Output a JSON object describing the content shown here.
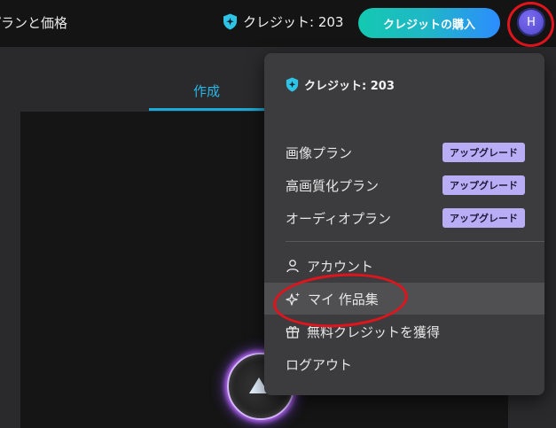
{
  "header": {
    "nav_link": "プランと価格",
    "credits_label": "クレジット: 203",
    "buy_button": "クレジットの購入",
    "avatar_initial": "H"
  },
  "workspace": {
    "active_tab": "作成"
  },
  "menu": {
    "credits_label": "クレジット: 203",
    "plans": [
      {
        "label": "画像プラン",
        "badge": "アップグレード"
      },
      {
        "label": "高画質化プラン",
        "badge": "アップグレード"
      },
      {
        "label": "オーディオプラン",
        "badge": "アップグレード"
      }
    ],
    "items": [
      {
        "label": "アカウント",
        "icon": "user-icon"
      },
      {
        "label": "マイ 作品集",
        "icon": "sparkles-icon"
      },
      {
        "label": "無料クレジットを獲得",
        "icon": "gift-icon"
      },
      {
        "label": "ログアウト",
        "icon": ""
      }
    ]
  },
  "colors": {
    "accent_blue": "#29b6e6",
    "button_gradient_start": "#14c9b1",
    "button_gradient_end": "#2d8cff",
    "upgrade_badge": "#b9aef5",
    "annotation_red": "#e0141c"
  }
}
